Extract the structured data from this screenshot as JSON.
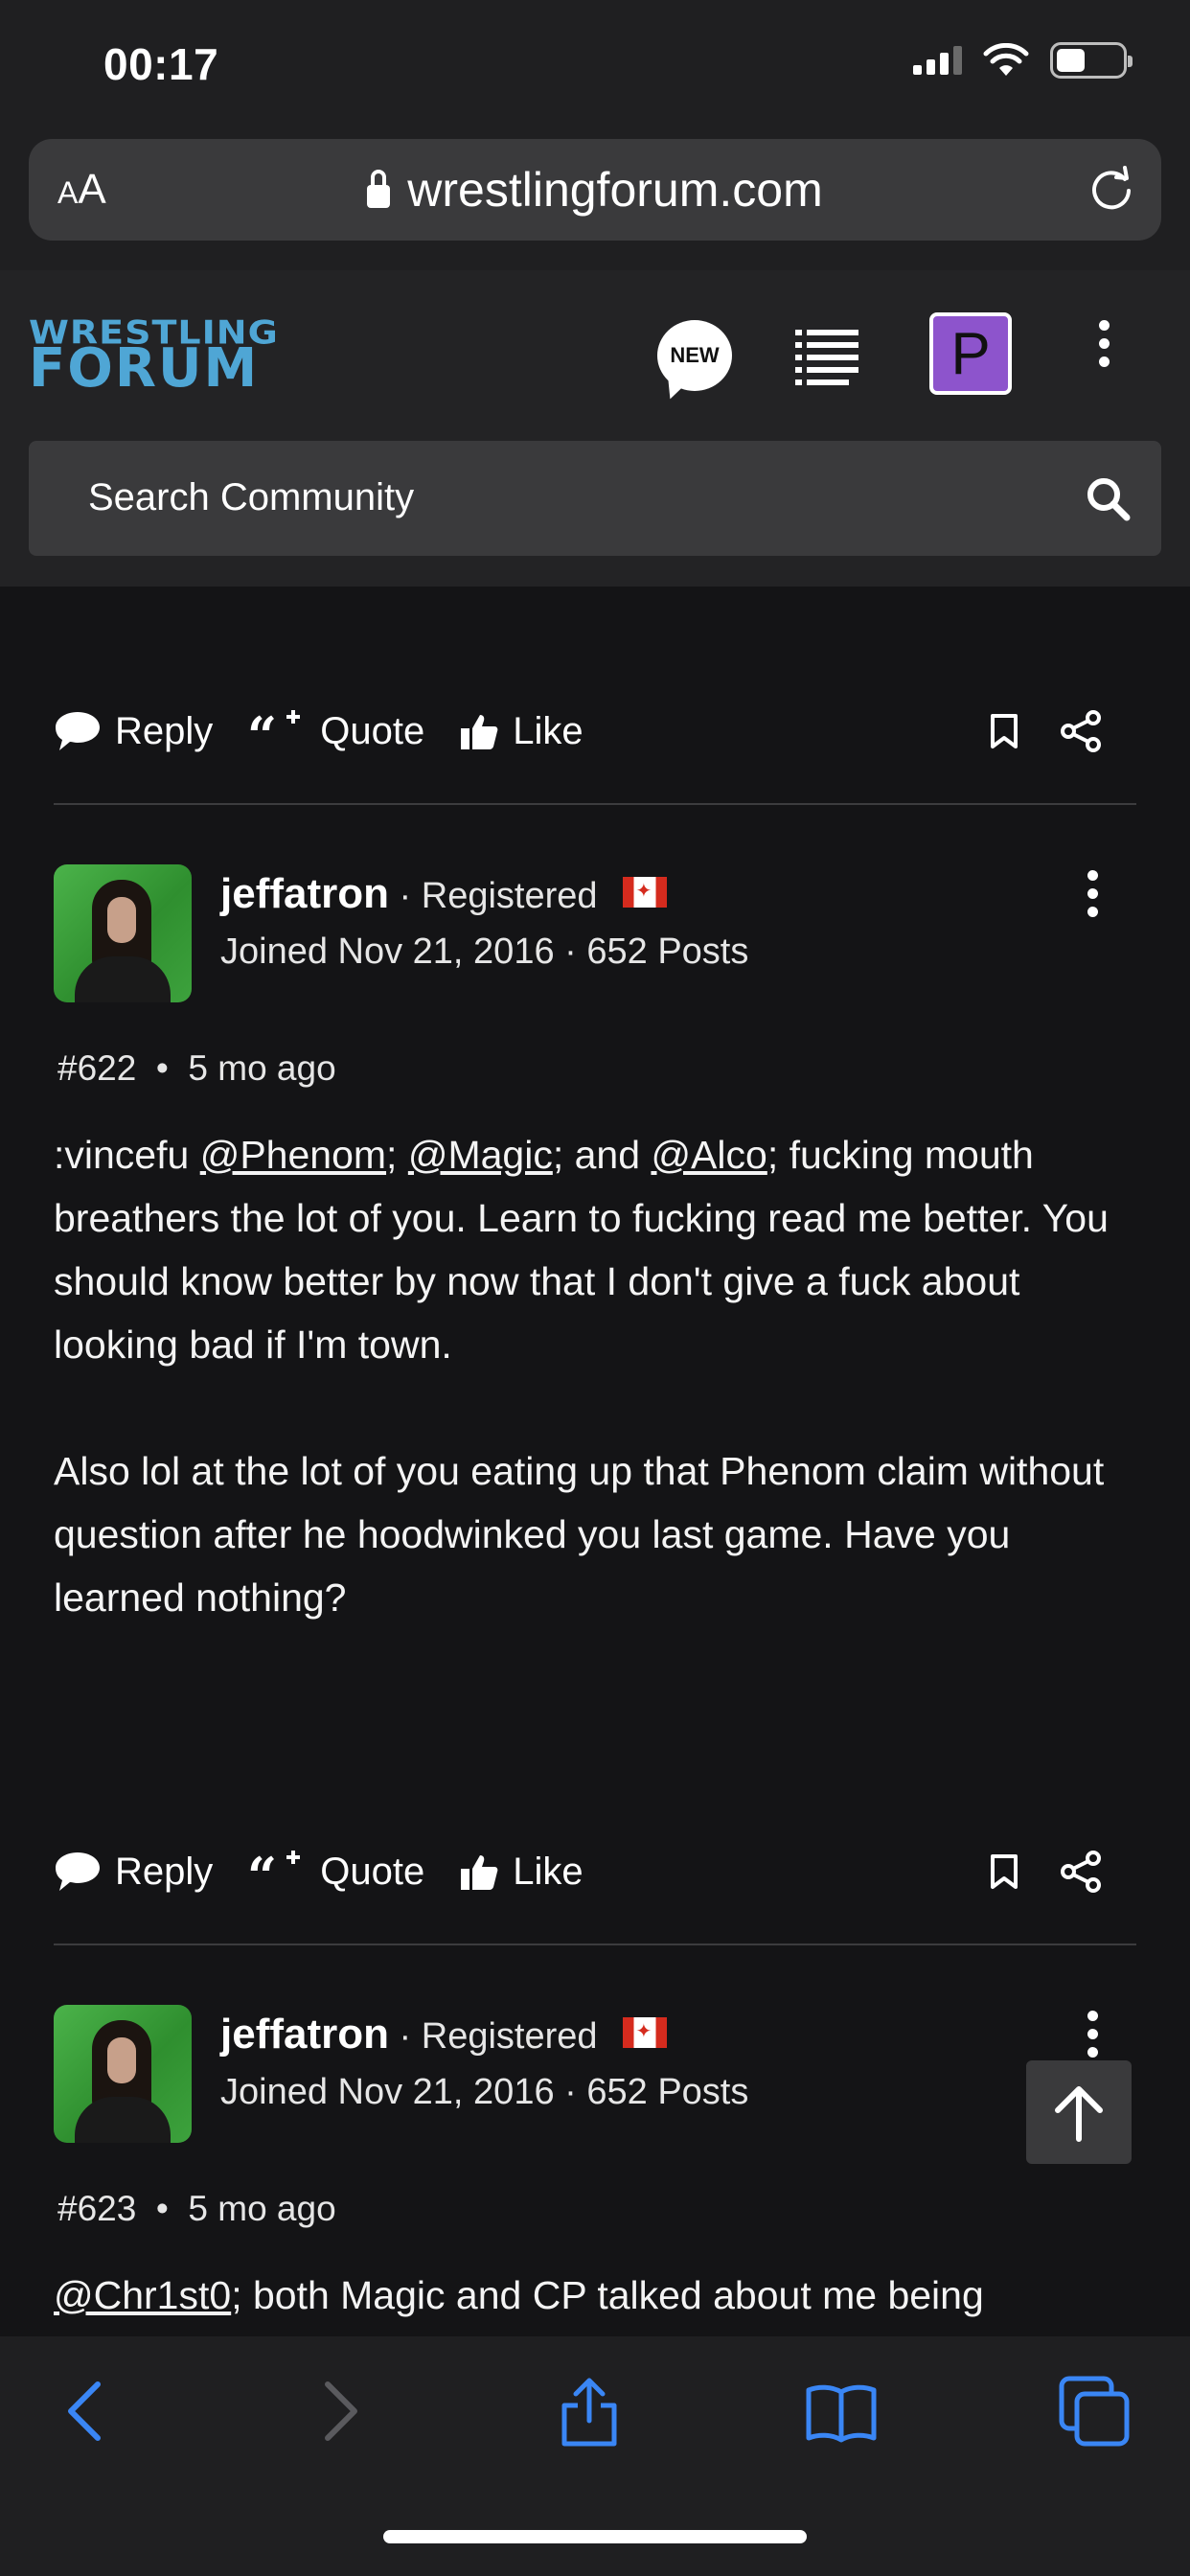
{
  "status": {
    "time": "00:17"
  },
  "browser": {
    "aa_label": "AA",
    "url": "wrestlingforum.com"
  },
  "site": {
    "logo_line1": "WRESTLING",
    "logo_line2": "FORUM",
    "new_label": "NEW",
    "profile_letter": "P",
    "search_placeholder": "Search Community"
  },
  "actions": {
    "reply": "Reply",
    "quote": "Quote",
    "like": "Like"
  },
  "posts": [
    {
      "username": "jeffatron",
      "role": " · Registered",
      "joined": "Joined Nov 21, 2016 · 652 Posts",
      "number": "#622",
      "age": "5 mo ago",
      "body_p1_prefix": ":vincefu ",
      "mention1": "@Phenom",
      "sep1": "; ",
      "mention2": "@Magic",
      "sep2": "; and ",
      "mention3": "@Alco",
      "body_p1_rest": "; fucking mouth breathers the lot of you. Learn to fucking read me better. You should know better by now that I don't give a fuck about looking bad if I'm town.",
      "body_p2": "Also lol at the lot of you eating up that Phenom claim without question after he hoodwinked you last game. Have you learned nothing?"
    },
    {
      "username": "jeffatron",
      "role": " · Registered",
      "joined": "Joined Nov 21, 2016 · 652 Posts",
      "number": "#623",
      "age": "5 mo ago",
      "mention1": "@Chr1st0",
      "body_rest": "; both Magic and CP talked about me being"
    }
  ],
  "icons": [
    "lock-icon",
    "reload-icon",
    "new-posts-icon",
    "list-icon",
    "kebab-icon",
    "search-icon",
    "reply-icon",
    "quote-icon",
    "like-icon",
    "bookmark-icon",
    "share-icon",
    "back-icon",
    "forward-icon",
    "share-sheet-icon",
    "bookmarks-icon",
    "tabs-icon",
    "arrow-up-icon"
  ],
  "colors": {
    "logo": "#4fa6d5",
    "toolbar_icons": "#3a86f5",
    "profile_badge": "#8d54cc"
  }
}
